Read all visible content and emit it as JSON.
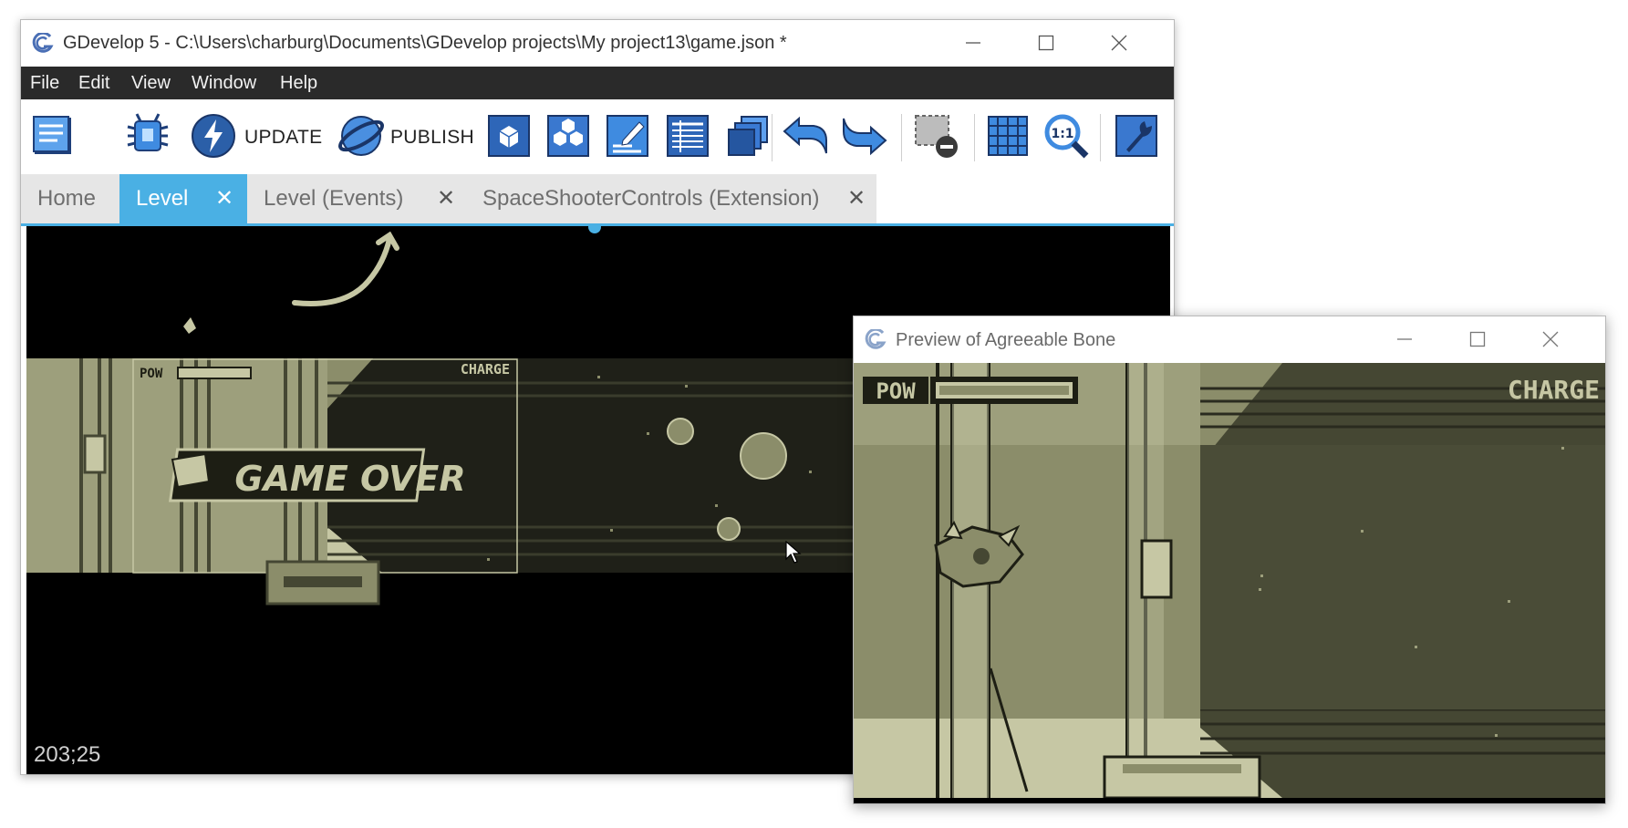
{
  "main_window": {
    "title": "GDevelop 5 - C:\\Users\\charburg\\Documents\\GDevelop projects\\My project13\\game.json *",
    "menu": [
      "File",
      "Edit",
      "View",
      "Window",
      "Help"
    ],
    "toolbar": {
      "update_label": "UPDATE",
      "publish_label": "PUBLISH",
      "icons": [
        "project-manager-icon",
        "debugger-icon",
        "update-icon",
        "publish-icon",
        "object-icon",
        "object-groups-icon",
        "properties-icon",
        "instances-list-icon",
        "layers-icon",
        "undo-icon",
        "redo-icon",
        "delete-selection-icon",
        "grid-icon",
        "zoom-reset-icon",
        "editor-settings-icon"
      ]
    },
    "tabs": [
      {
        "label": "Home",
        "closable": false,
        "active": false
      },
      {
        "label": "Level",
        "closable": true,
        "active": true
      },
      {
        "label": "Level (Events)",
        "closable": true,
        "active": false
      },
      {
        "label": "SpaceShooterControls (Extension)",
        "closable": true,
        "active": false
      }
    ],
    "scene": {
      "cursor_coords": "203;25",
      "hud_left": "POW",
      "hud_right": "CHARGE",
      "game_over_text": "GAME OVER"
    }
  },
  "preview_window": {
    "title": "Preview of Agreeable Bone",
    "hud_left": "POW",
    "hud_right": "CHARGE"
  },
  "colors": {
    "tab_active": "#4ab0e4",
    "menubar": "#2a2a2a",
    "gameboy_light": "#c6c7a4",
    "gameboy_mid": "#8b8d6a",
    "gameboy_dark": "#454733",
    "gameboy_darkest": "#1d1e14"
  }
}
